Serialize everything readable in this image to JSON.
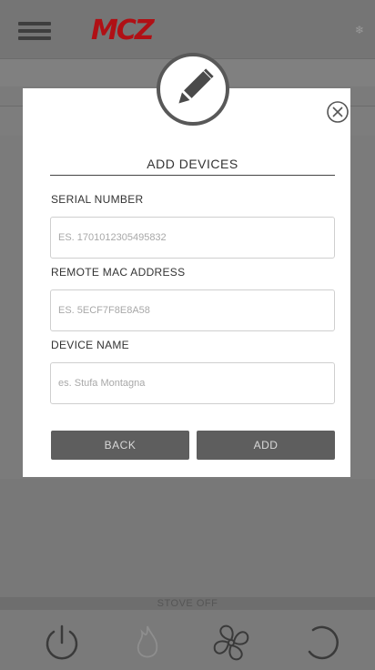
{
  "app": {
    "logo": "MCZ"
  },
  "background": {
    "status_bar": "STOVE OFF"
  },
  "dialog": {
    "title": "ADD DEVICES",
    "serial": {
      "label": "SERIAL NUMBER",
      "placeholder": "ES. 1701012305495832"
    },
    "mac": {
      "label": "REMOTE MAC ADDRESS",
      "placeholder": "ES. 5ECF7F8E8A58"
    },
    "name": {
      "label": "DEVICE NAME",
      "placeholder": "es. Stufa Montagna"
    },
    "back_label": "BACK",
    "add_label": "ADD"
  },
  "icons": {
    "menu": "hamburger-menu-icon",
    "settings": "snowflake-icon",
    "edit": "pencil-icon",
    "close": "close-circle-x-icon",
    "power": "power-icon",
    "flame": "flame-icon",
    "fan": "fan-icon",
    "refresh": "refresh-icon"
  },
  "colors": {
    "brand": "#b01015",
    "button": "#5e5e5e",
    "overlay": "#7b7b7b"
  }
}
